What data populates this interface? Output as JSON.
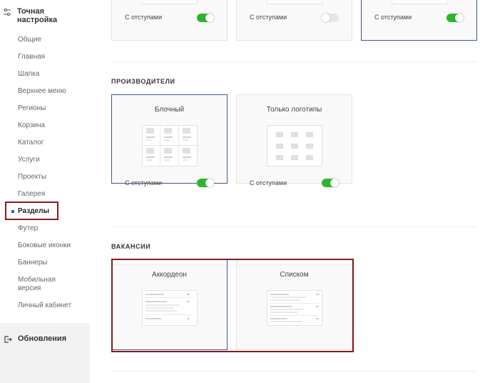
{
  "sidebar": {
    "title": "Точная настройка",
    "title_icon": "sliders-icon",
    "items": [
      {
        "label": "Общие"
      },
      {
        "label": "Главная"
      },
      {
        "label": "Шапка"
      },
      {
        "label": "Верхнее меню"
      },
      {
        "label": "Регионы"
      },
      {
        "label": "Корзина"
      },
      {
        "label": "Каталог"
      },
      {
        "label": "Услуги"
      },
      {
        "label": "Проекты"
      },
      {
        "label": "Галерея"
      },
      {
        "label": "Разделы"
      },
      {
        "label": "Футер"
      },
      {
        "label": "Боковые иконки"
      },
      {
        "label": "Баннеры"
      },
      {
        "label": "Мобильная версия"
      },
      {
        "label": "Личный кабинет"
      }
    ],
    "active_item": "Разделы",
    "updates": {
      "label": "Обновления",
      "icon": "logout-icon"
    }
  },
  "top_cards": [
    {
      "option_label": "С отступами",
      "toggle_on": true,
      "selected": false
    },
    {
      "option_label": "С отступами",
      "toggle_on": false,
      "selected": false
    },
    {
      "option_label": "С отступами",
      "toggle_on": true,
      "selected": true
    }
  ],
  "manufacturers": {
    "title": "ПРОИЗВОДИТЕЛИ",
    "cards": [
      {
        "title": "Блочный",
        "option_label": "С отступами",
        "toggle_on": true,
        "selected": true
      },
      {
        "title": "Только логотипы",
        "option_label": "С отступами",
        "toggle_on": true,
        "selected": false
      }
    ]
  },
  "vacancies": {
    "title": "ВАКАНСИИ",
    "cards": [
      {
        "title": "Аккордеон",
        "selected": true
      },
      {
        "title": "Списком",
        "selected": false
      }
    ]
  },
  "colors": {
    "accent": "#3e5a86",
    "toggle_on": "#2db52d",
    "highlight": "#8b1a1a",
    "updates_bg": "#f2f2f2"
  }
}
